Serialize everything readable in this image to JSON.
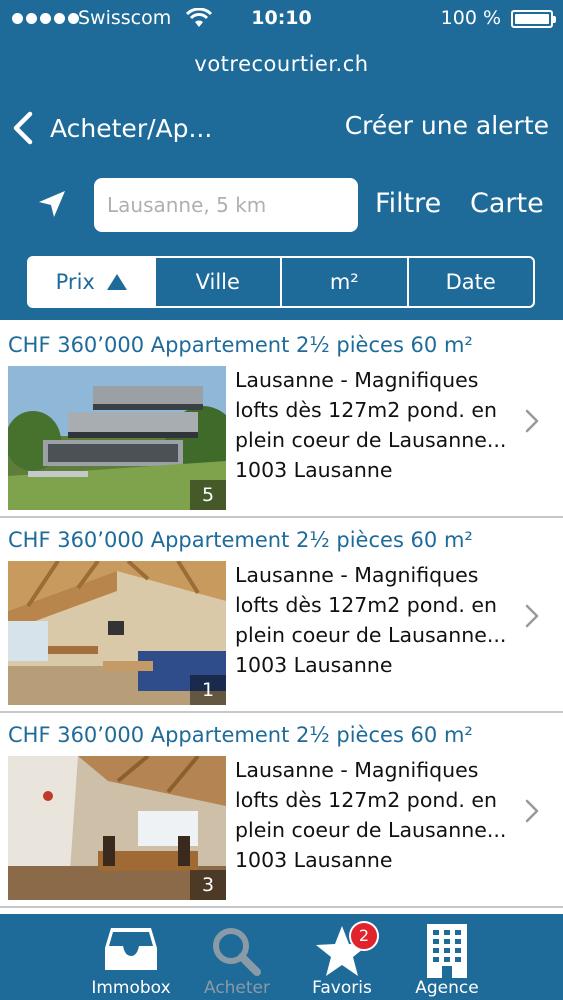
{
  "status_bar": {
    "carrier": "Swisscom",
    "time": "10:10",
    "battery": "100 %"
  },
  "site": "votrecourtier.ch",
  "nav": {
    "back_label": "Acheter/Ap...",
    "alert_label": "Créer une alerte"
  },
  "search": {
    "placeholder": "Lausanne, 5 km",
    "filter_label": "Filtre",
    "map_label": "Carte"
  },
  "sort_tabs": [
    {
      "label": "Prix",
      "selected": true,
      "icon": "sort-ascending-triangle"
    },
    {
      "label": "Ville",
      "selected": false
    },
    {
      "label": "m²",
      "selected": false
    },
    {
      "label": "Date",
      "selected": false
    }
  ],
  "listings": [
    {
      "title": "CHF 360’000 Appartement 2½ pièces 60 m²",
      "lines": [
        "Lausanne - Magnifiques",
        "lofts dès 127m2 pond. en",
        "plein coeur de Lausanne...",
        "1003 Lausanne"
      ],
      "photo_count": "5",
      "photo": "building-exterior"
    },
    {
      "title": "CHF 360’000 Appartement 2½ pièces 60 m²",
      "lines": [
        "Lausanne - Magnifiques",
        "lofts dès 127m2 pond. en",
        "plein coeur de Lausanne...",
        "1003 Lausanne"
      ],
      "photo_count": "1",
      "photo": "attic-living-room"
    },
    {
      "title": "CHF 360’000 Appartement 2½ pièces 60 m²",
      "lines": [
        "Lausanne - Magnifiques",
        "lofts dès 127m2 pond. en",
        "plein coeur de Lausanne...",
        "1003 Lausanne"
      ],
      "photo_count": "3",
      "photo": "attic-dining-room"
    }
  ],
  "tab_bar": [
    {
      "label": "Immobox",
      "icon": "inbox-icon",
      "active": false
    },
    {
      "label": "Acheter",
      "icon": "search-icon",
      "active": true
    },
    {
      "label": "Favoris",
      "icon": "star-icon",
      "active": false,
      "badge": "2"
    },
    {
      "label": "Agence",
      "icon": "building-icon",
      "active": false
    }
  ],
  "colors": {
    "brand": "#1e6b9a",
    "badge": "#e2232c",
    "inactive_tab": "#8a9aa6"
  }
}
